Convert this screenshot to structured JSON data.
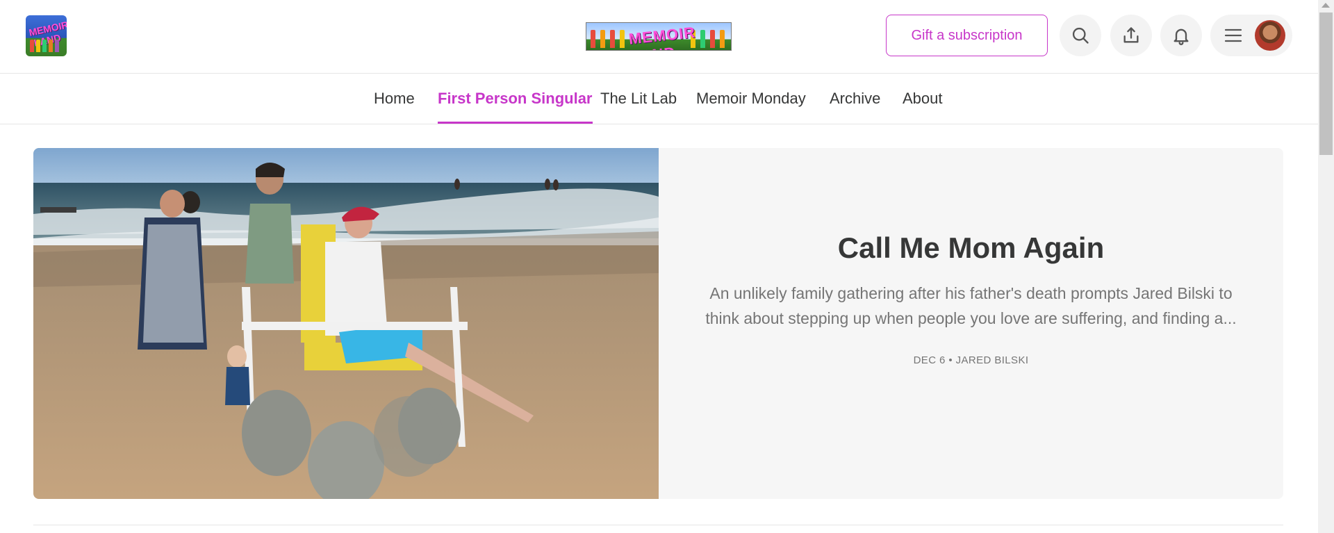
{
  "header": {
    "logo_text": "MEMOIR LAND",
    "gift_button_label": "Gift a subscription",
    "icons": [
      "search-icon",
      "share-icon",
      "bell-icon",
      "menu-icon"
    ]
  },
  "nav": {
    "items": [
      {
        "label": "Home",
        "active": false
      },
      {
        "label": "First Person Singular",
        "active": true
      },
      {
        "label": "The Lit Lab",
        "active": false
      },
      {
        "label": "Memoir Monday",
        "active": false
      },
      {
        "label": "Archive",
        "active": false
      },
      {
        "label": "About",
        "active": false
      }
    ]
  },
  "featured": {
    "title": "Call Me Mom Again",
    "subtitle": "An unlikely family gathering after his father's death prompts Jared Bilski to think about stepping up when people you love are suffering, and finding a...",
    "date": "DEC 6",
    "separator": "•",
    "author": "JARED BILSKI"
  },
  "colors": {
    "accent": "#c736c9",
    "text": "#363737",
    "muted": "#757575",
    "card_bg": "#f6f6f6"
  }
}
